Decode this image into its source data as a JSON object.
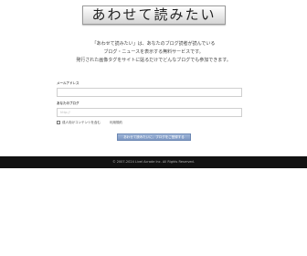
{
  "logo": {
    "text": "あわせて読みたい"
  },
  "intro": {
    "line1": "「あわせて読みたい」は、あなたのブログ読者が読んでいる",
    "line2": "ブログ・ニュースを表示する無料サービスです。",
    "line3": "発行された画像タグをサイトに貼るだけでどんなブログでも参加できます。"
  },
  "form": {
    "email_label": "メールアドレス",
    "email_value": "",
    "blog_label": "あなたのブログ",
    "blog_placeholder": "http://",
    "adult_checkbox_label": "成人向けコンテンツを含む",
    "terms_link": "利用規約",
    "submit_label": "あわせて読みたいに、ブログをご登録する"
  },
  "footer": {
    "copyright": "© 2007-2024 Livel Acrade Inc. All Rights Reserved."
  }
}
